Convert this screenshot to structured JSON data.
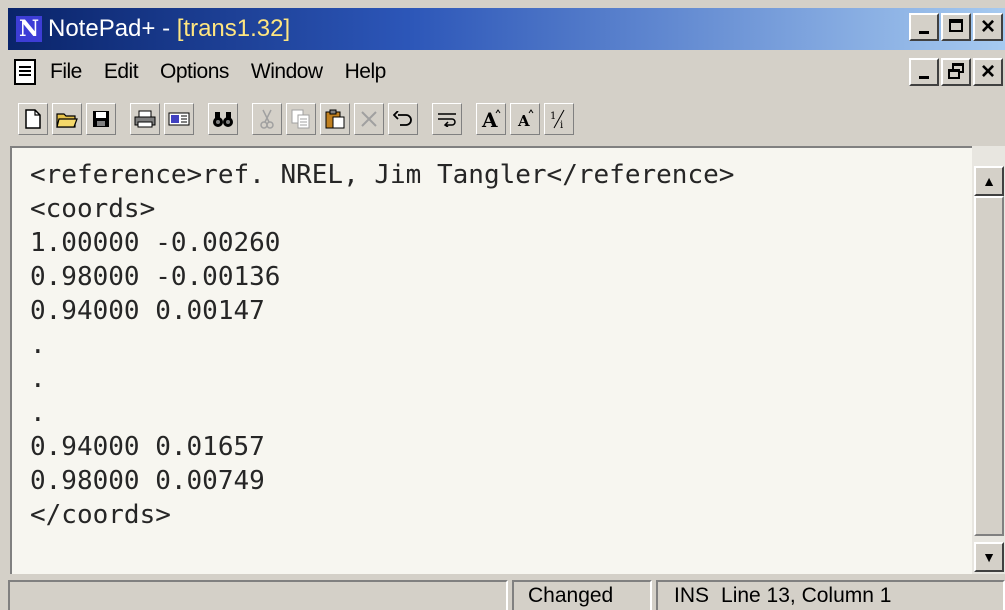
{
  "window": {
    "title_app": "NotePad+ - ",
    "title_doc": "[trans1.32]",
    "app_icon_letter": "N"
  },
  "menu": [
    "File",
    "Edit",
    "Options",
    "Window",
    "Help"
  ],
  "toolbar": {
    "icons": [
      "new-file-icon",
      "open-folder-icon",
      "save-disk-icon",
      "print-icon",
      "email-icon",
      "find-binoculars-icon",
      "cut-scissors-icon",
      "copy-icon",
      "paste-clipboard-icon",
      "delete-x-icon",
      "undo-icon",
      "wrap-icon",
      "font-larger-icon",
      "font-smaller-icon",
      "fraction-icon"
    ]
  },
  "editor": {
    "lines": [
      "<reference>ref. NREL, Jim Tangler</reference>",
      "<coords>",
      "1.00000 -0.00260",
      "0.98000 -0.00136",
      "0.94000 0.00147",
      ".",
      ".",
      ".",
      "0.94000 0.01657",
      "0.98000 0.00749",
      "</coords>"
    ]
  },
  "status": {
    "modified": "Changed",
    "mode": "INS",
    "position": "Line 13, Column 1"
  },
  "colors": {
    "title_gradient_start": "#0a246a",
    "title_gradient_end": "#a6caf0",
    "chrome": "#d4d0c8",
    "editor_bg": "#f7f6f0"
  }
}
